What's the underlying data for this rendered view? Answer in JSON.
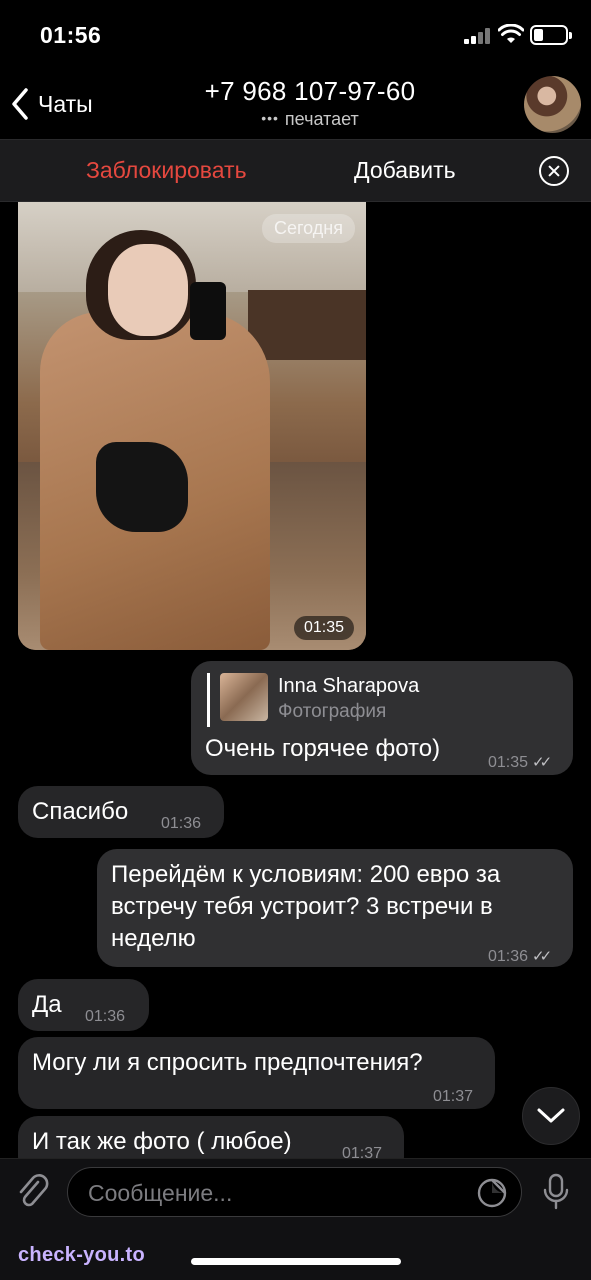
{
  "status": {
    "time": "01:56"
  },
  "header": {
    "back_label": "Чаты",
    "title": "+7 968 107-97-60",
    "subtitle_dots": "•••",
    "subtitle": "печатает"
  },
  "actions": {
    "block": "Заблокировать",
    "add": "Добавить"
  },
  "photo_message": {
    "date_badge": "Сегодня",
    "time": "01:35"
  },
  "messages": [
    {
      "dir": "out",
      "reply_name": "Inna Sharapova",
      "reply_sub": "Фотография",
      "text": "Очень горячее фото)",
      "time": "01:35"
    },
    {
      "dir": "in",
      "text": "Спасибо",
      "time": "01:36"
    },
    {
      "dir": "out",
      "text": "Перейдём к условиям: 200 евро за встречу тебя устроит? 3 встречи в неделю",
      "time": "01:36"
    },
    {
      "dir": "in",
      "text": "Да",
      "time": "01:36"
    },
    {
      "dir": "in",
      "text": "Могу ли я спросить предпочтения?",
      "time": "01:37"
    },
    {
      "dir": "in",
      "text": "И так же фото ( любое)",
      "time": "01:37"
    }
  ],
  "input": {
    "placeholder": "Сообщение..."
  },
  "watermark": "check-you.to",
  "colors": {
    "block": "#e5483f",
    "incoming": "#262628",
    "outgoing": "#303032"
  }
}
